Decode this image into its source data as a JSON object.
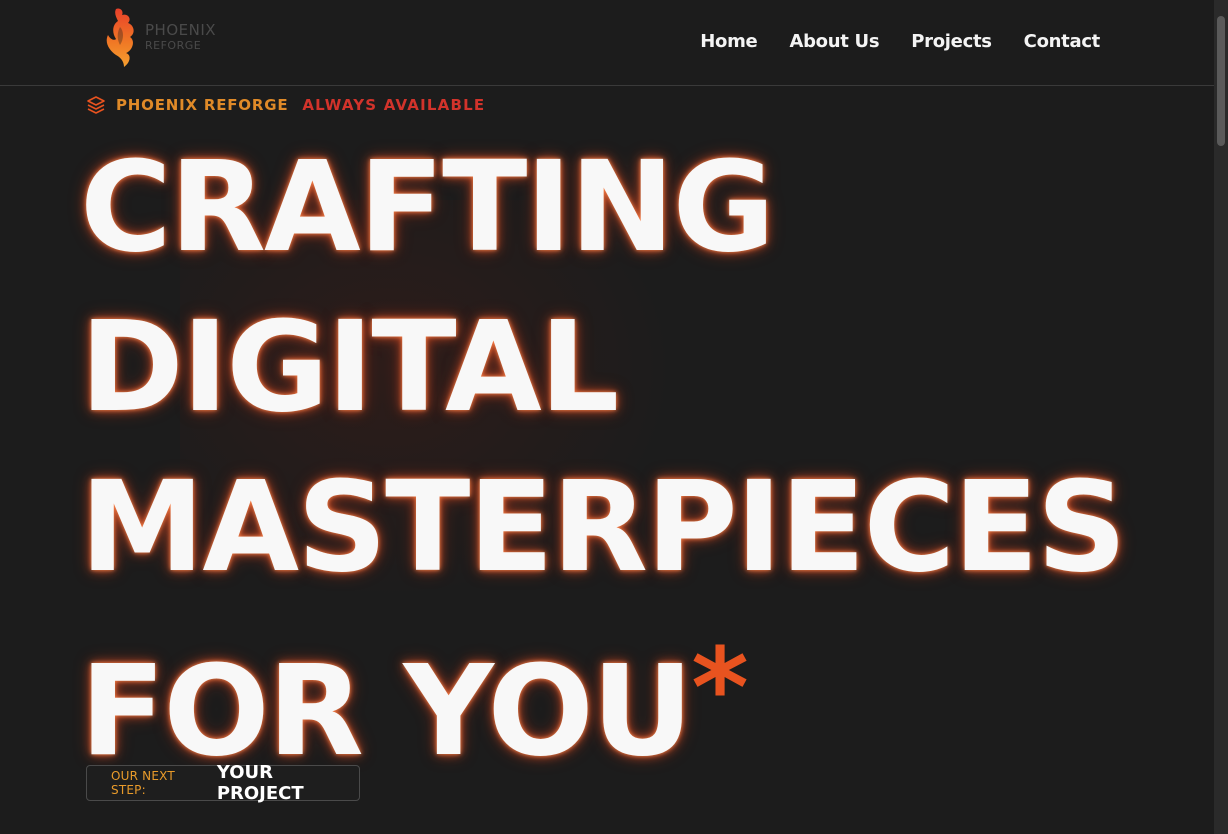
{
  "header": {
    "logo": {
      "main": "PHOENIX",
      "sub": "REFORGE",
      "icon": "phoenix-logo-icon"
    },
    "nav": [
      {
        "label": "Home"
      },
      {
        "label": "About Us"
      },
      {
        "label": "Projects"
      },
      {
        "label": "Contact"
      }
    ]
  },
  "tagline": {
    "icon": "layers-icon",
    "brand": "PHOENIX REFORGE",
    "status": "ALWAYS AVAILABLE"
  },
  "hero": {
    "lines": [
      "CRAFTING",
      "DIGITAL",
      "MASTERPIECES",
      "FOR YOU"
    ],
    "asterisk": "*"
  },
  "next_step": {
    "label": "OUR NEXT STEP:",
    "value": "YOUR PROJECT"
  },
  "colors": {
    "background": "#1c1c1c",
    "accent_orange": "#e08a28",
    "accent_red": "#d2332b",
    "asterisk": "#e8531f",
    "text": "#f8f8f8"
  }
}
